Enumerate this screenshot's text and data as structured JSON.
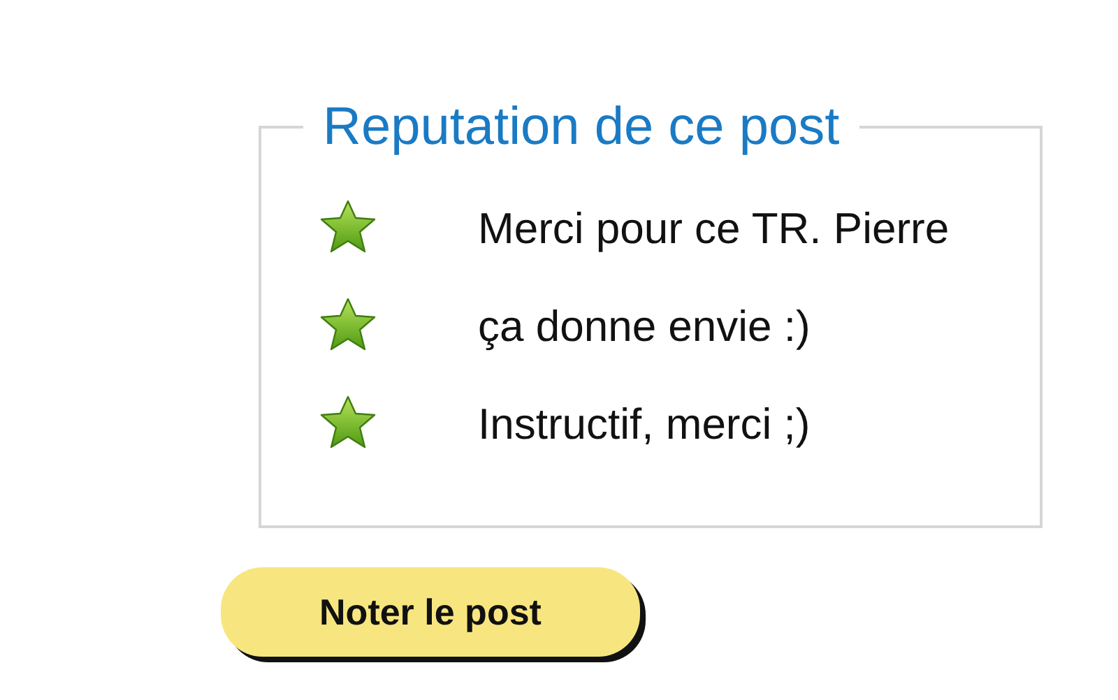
{
  "panel": {
    "title": "Reputation de ce post",
    "comments": [
      {
        "text": "Merci pour ce TR. Pierre"
      },
      {
        "text": "ça donne envie :)"
      },
      {
        "text": "Instructif, merci ;)"
      }
    ]
  },
  "button": {
    "label": "Noter le post"
  }
}
